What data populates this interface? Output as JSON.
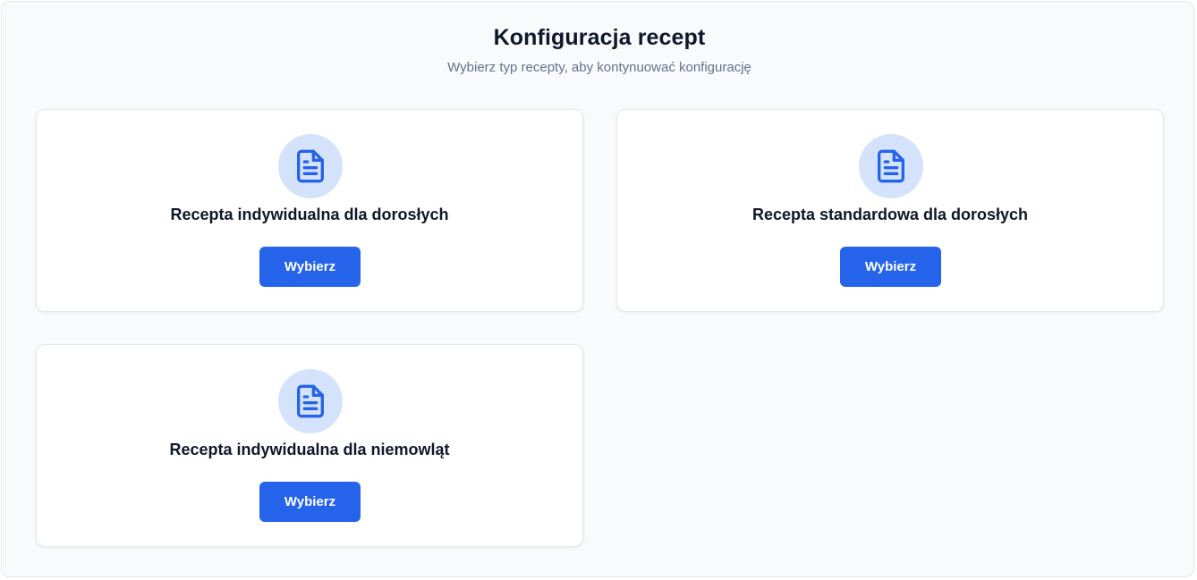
{
  "header": {
    "title": "Konfiguracja recept",
    "subtitle": "Wybierz typ recepty, aby kontynuować konfigurację"
  },
  "cards": [
    {
      "icon": "document-icon",
      "title": "Recepta indywidualna dla dorosłych",
      "button_label": "Wybierz"
    },
    {
      "icon": "document-icon",
      "title": "Recepta standardowa dla dorosłych",
      "button_label": "Wybierz"
    },
    {
      "icon": "document-icon",
      "title": "Recepta indywidualna dla niemowląt",
      "button_label": "Wybierz"
    }
  ],
  "colors": {
    "accent": "#2563eb",
    "icon_background": "#d4e2fb",
    "page_background": "#f8fafc",
    "card_background": "#ffffff",
    "title_text": "#0f172a",
    "subtitle_text": "#64748b"
  }
}
